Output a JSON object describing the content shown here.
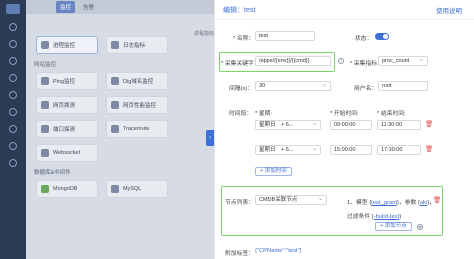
{
  "bg": {
    "tabs": [
      "监控",
      "告警"
    ],
    "section_hosts": "网站监控",
    "section_db": "数据库&中间件",
    "cards": [
      "进程监控",
      "日志指标",
      "Ping监控",
      "Dig域名监控",
      "网页拨测",
      "网页性能监控",
      "端口探测",
      "Traceroute",
      "Websocket",
      "MongoDB",
      "MySQL"
    ],
    "right_label": "进程指标"
  },
  "drawer": {
    "title": "编辑：test",
    "help": "使用说明",
    "name_label": "* 名称：",
    "name_value": "test",
    "status_label": "状态：",
    "keyword_label": "* 采集关键字：",
    "keyword_value": "/apps/{{env}}/{{cmd}}",
    "metric_label": "* 采集指标：",
    "metric_value": "proc_count",
    "interval_label": "间隔(s)：",
    "interval_value": "30",
    "user_label": "用户名：",
    "user_value": "root",
    "time_label": "时间段：",
    "week_header": "* 星期:",
    "start_header": "* 开始时间:",
    "end_header": "* 结束时间:",
    "rows": [
      {
        "week": "星期日",
        "more": "+ 6...",
        "start": "09:00:00",
        "end": "11:30:00"
      },
      {
        "week": "星期日",
        "more": "+ 6...",
        "start": "15:00:00",
        "end": "17:30:00"
      }
    ],
    "add_time": "+ 添加时间",
    "node_label": "节点列表：",
    "node_value": "CMDB关联节点",
    "node_line1_prefix": "1、模型 {",
    "node_model": "test_grant",
    "node_line1_mid": "}，参数 {",
    "node_param": "aki",
    "node_line1_suffix": "}，",
    "node_filter_prefix": "过滤条件 {",
    "node_filter": "-build-test",
    "node_filter_suffix": "}",
    "add_node": "+ 添加节点",
    "extra_label": "附加标签：",
    "extra_value": "{\"CPName\":\"test\"}"
  }
}
